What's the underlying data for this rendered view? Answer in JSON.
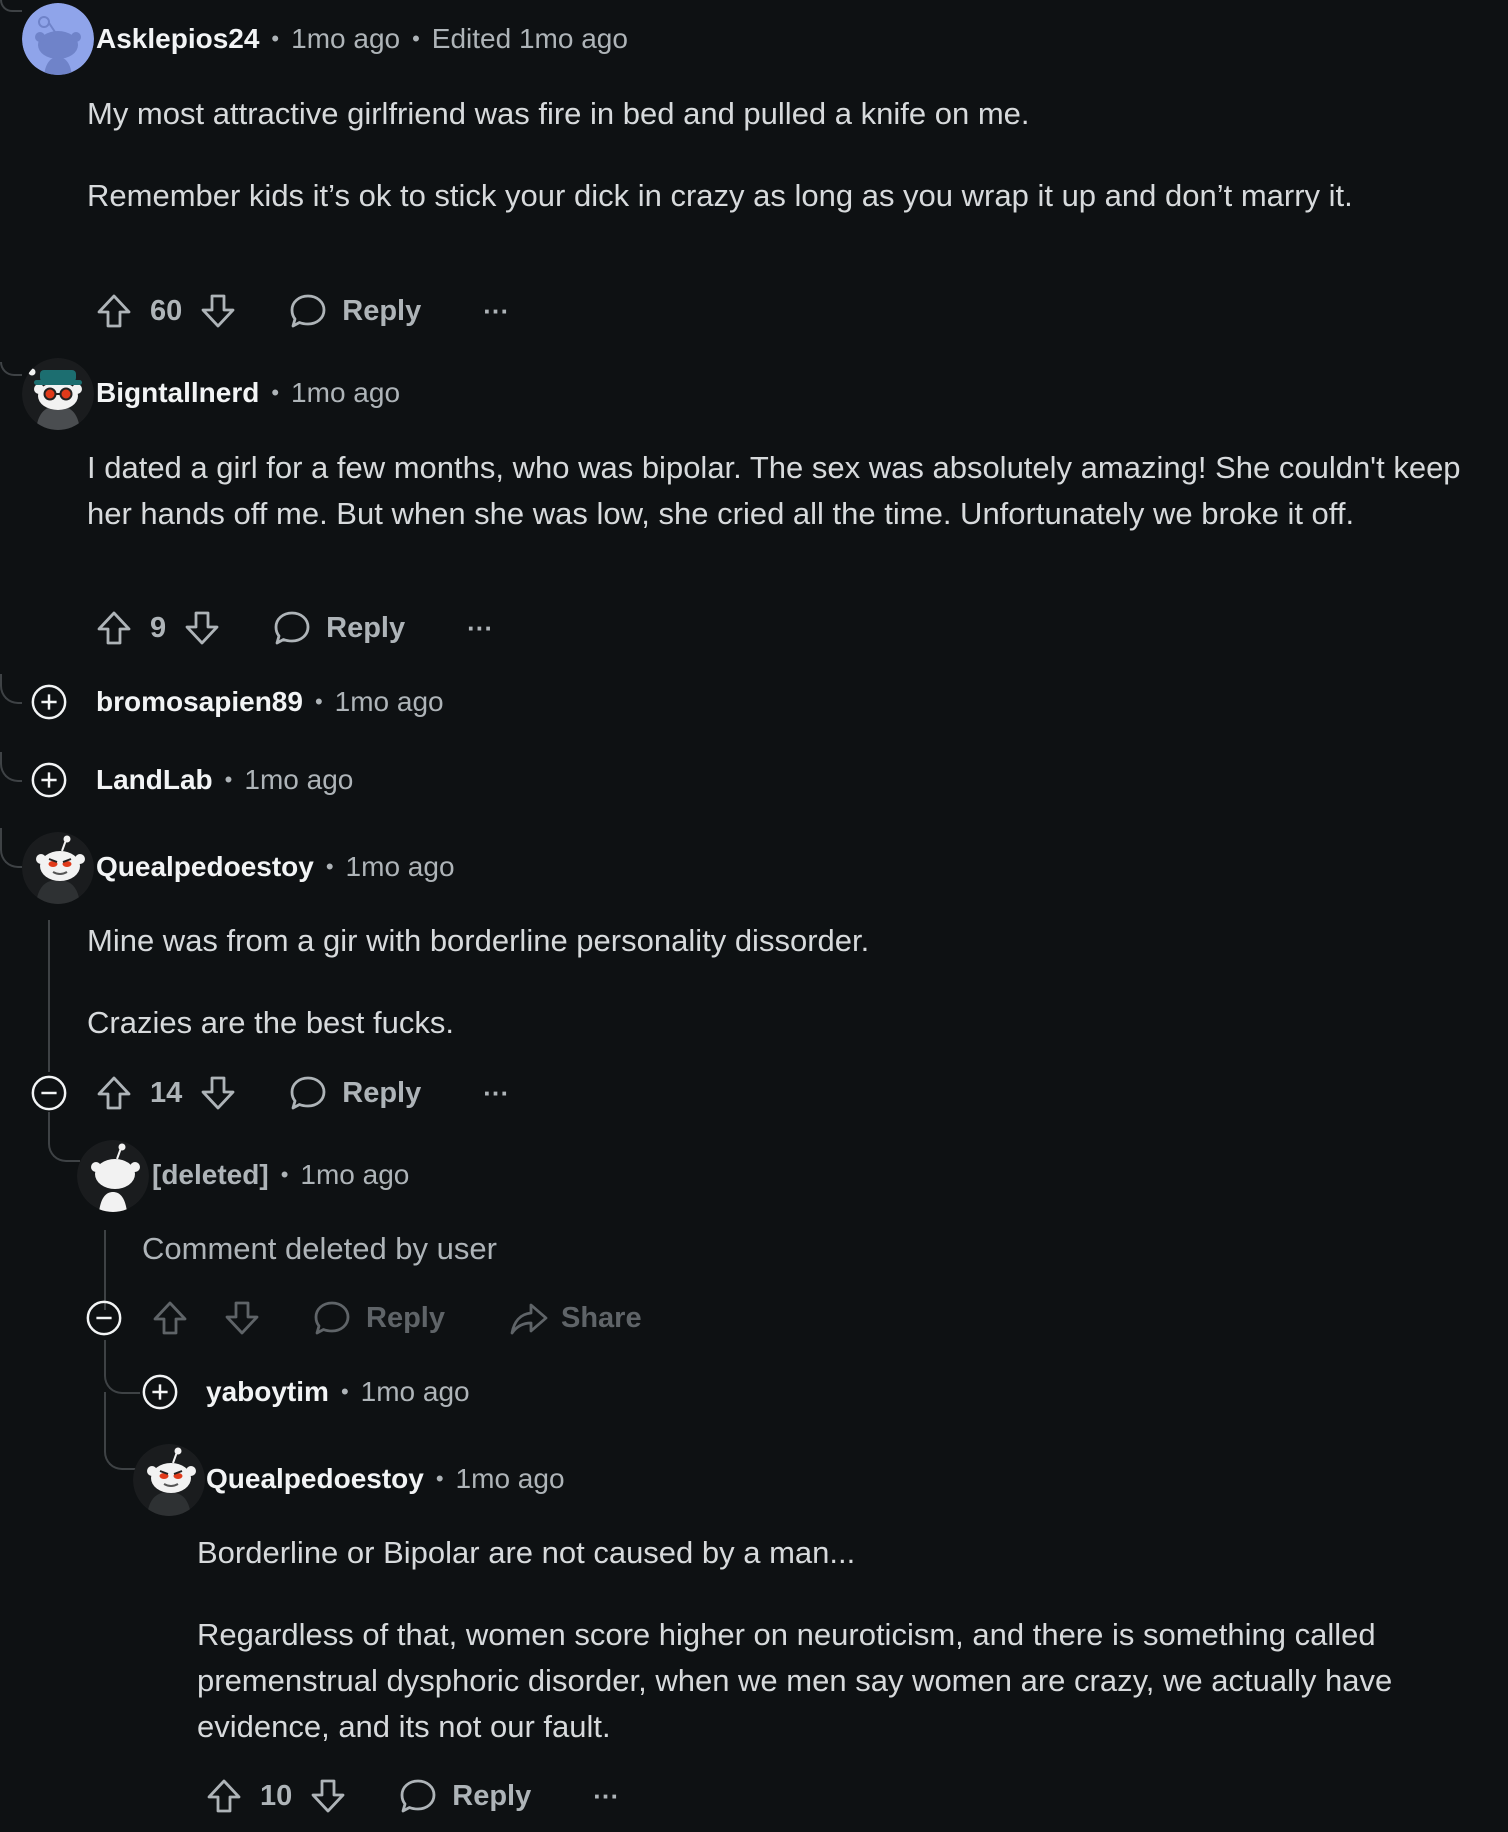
{
  "comments": [
    {
      "username": "Asklepios24",
      "time": "1mo ago",
      "edited": "Edited 1mo ago",
      "paragraphs": [
        "My most attractive girlfriend was fire in bed and pulled a knife on me.",
        "Remember kids it’s ok to stick your dick in crazy as long as you wrap it up and don’t marry it."
      ],
      "votes": "60",
      "reply_label": "Reply",
      "more": "···"
    },
    {
      "username": "Bigntallnerd",
      "time": "1mo ago",
      "paragraphs": [
        "I dated a girl for a few months, who was bipolar. The sex was absolutely amazing! She couldn't keep her hands off me. But when she was low, she cried all the time. Unfortunately we broke it off."
      ],
      "votes": "9",
      "reply_label": "Reply",
      "more": "···"
    },
    {
      "username": "bromosapien89",
      "time": "1mo ago"
    },
    {
      "username": "LandLab",
      "time": "1mo ago"
    },
    {
      "username": "Quealpedoestoy",
      "time": "1mo ago",
      "paragraphs": [
        "Mine was from a gir with borderline personality dissorder.",
        "Crazies are the best fucks."
      ],
      "votes": "14",
      "reply_label": "Reply",
      "more": "···"
    },
    {
      "username": "[deleted]",
      "time": "1mo ago",
      "paragraphs": [
        "Comment deleted by user"
      ],
      "reply_label": "Reply",
      "share_label": "Share"
    },
    {
      "username": "yaboytim",
      "time": "1mo ago"
    },
    {
      "username": "Quealpedoestoy",
      "time": "1mo ago",
      "paragraphs": [
        "Borderline or Bipolar are not caused by a man...",
        "Regardless of that, women score higher on neuroticism, and there is something called premenstrual dysphoric disorder, when we men say women are crazy, we actually have evidence, and its not our fault."
      ],
      "votes": "10",
      "reply_label": "Reply",
      "more": "···"
    }
  ],
  "colors": {
    "background": "#0e1113",
    "text": "#d7dadc",
    "muted": "#aeb4b8",
    "thread_line": "#3e4245",
    "avatar_blue": "#8fa4ea"
  }
}
